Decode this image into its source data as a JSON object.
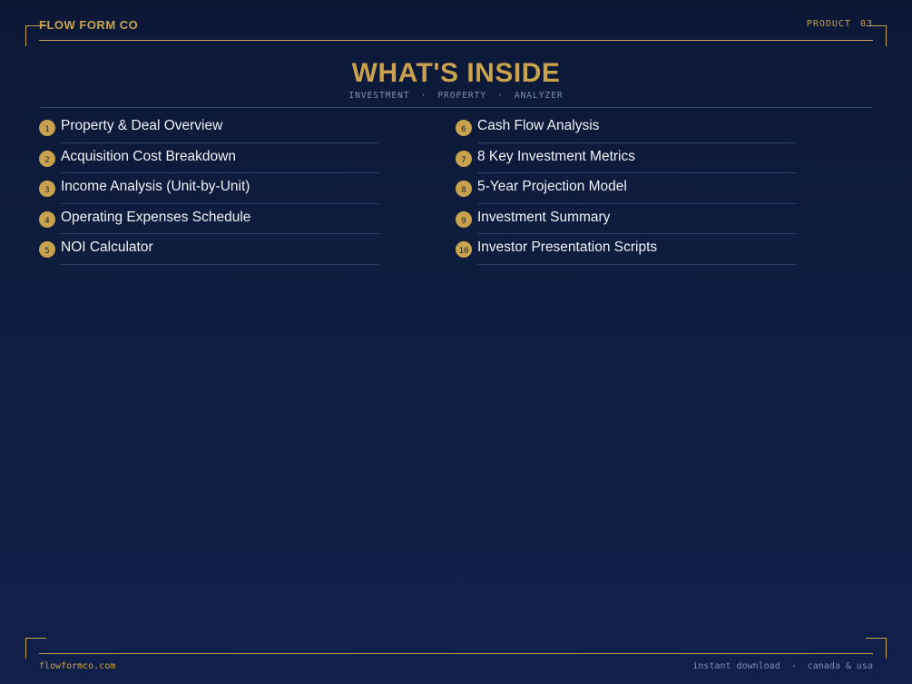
{
  "header": {
    "brand": "FLOW FORM CO",
    "product_label": "PRODUCT",
    "product_number": "03"
  },
  "hero": {
    "title": "WHAT'S INSIDE",
    "subtitle": [
      "INVESTMENT",
      "PROPERTY",
      "ANALYZER"
    ],
    "separator": "·"
  },
  "contents": {
    "left": [
      {
        "num": "1",
        "label": "Property & Deal Overview"
      },
      {
        "num": "2",
        "label": "Acquisition Cost Breakdown"
      },
      {
        "num": "3",
        "label": "Income Analysis (Unit-by-Unit)"
      },
      {
        "num": "4",
        "label": "Operating Expenses Schedule"
      },
      {
        "num": "5",
        "label": "NOI Calculator"
      }
    ],
    "right": [
      {
        "num": "6",
        "label": "Cash Flow Analysis"
      },
      {
        "num": "7",
        "label": "8 Key Investment Metrics"
      },
      {
        "num": "8",
        "label": "5-Year Projection Model"
      },
      {
        "num": "9",
        "label": "Investment Summary"
      },
      {
        "num": "10",
        "label": "Investor Presentation Scripts"
      }
    ]
  },
  "footer": {
    "website": "flowformco.com",
    "note_1": "instant download",
    "separator": "·",
    "note_2": "canada & usa"
  },
  "colors": {
    "accent": "#c9a24d",
    "background": "#0f1d3f",
    "muted_text": "#7f8db0",
    "text": "#f1f2f6"
  }
}
